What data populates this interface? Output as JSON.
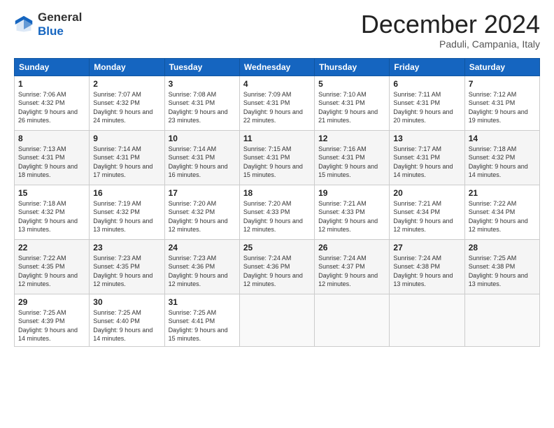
{
  "logo": {
    "general": "General",
    "blue": "Blue"
  },
  "header": {
    "title": "December 2024",
    "subtitle": "Paduli, Campania, Italy"
  },
  "weekdays": [
    "Sunday",
    "Monday",
    "Tuesday",
    "Wednesday",
    "Thursday",
    "Friday",
    "Saturday"
  ],
  "weeks": [
    [
      {
        "day": "1",
        "sunrise": "Sunrise: 7:06 AM",
        "sunset": "Sunset: 4:32 PM",
        "daylight": "Daylight: 9 hours and 26 minutes."
      },
      {
        "day": "2",
        "sunrise": "Sunrise: 7:07 AM",
        "sunset": "Sunset: 4:32 PM",
        "daylight": "Daylight: 9 hours and 24 minutes."
      },
      {
        "day": "3",
        "sunrise": "Sunrise: 7:08 AM",
        "sunset": "Sunset: 4:31 PM",
        "daylight": "Daylight: 9 hours and 23 minutes."
      },
      {
        "day": "4",
        "sunrise": "Sunrise: 7:09 AM",
        "sunset": "Sunset: 4:31 PM",
        "daylight": "Daylight: 9 hours and 22 minutes."
      },
      {
        "day": "5",
        "sunrise": "Sunrise: 7:10 AM",
        "sunset": "Sunset: 4:31 PM",
        "daylight": "Daylight: 9 hours and 21 minutes."
      },
      {
        "day": "6",
        "sunrise": "Sunrise: 7:11 AM",
        "sunset": "Sunset: 4:31 PM",
        "daylight": "Daylight: 9 hours and 20 minutes."
      },
      {
        "day": "7",
        "sunrise": "Sunrise: 7:12 AM",
        "sunset": "Sunset: 4:31 PM",
        "daylight": "Daylight: 9 hours and 19 minutes."
      }
    ],
    [
      {
        "day": "8",
        "sunrise": "Sunrise: 7:13 AM",
        "sunset": "Sunset: 4:31 PM",
        "daylight": "Daylight: 9 hours and 18 minutes."
      },
      {
        "day": "9",
        "sunrise": "Sunrise: 7:14 AM",
        "sunset": "Sunset: 4:31 PM",
        "daylight": "Daylight: 9 hours and 17 minutes."
      },
      {
        "day": "10",
        "sunrise": "Sunrise: 7:14 AM",
        "sunset": "Sunset: 4:31 PM",
        "daylight": "Daylight: 9 hours and 16 minutes."
      },
      {
        "day": "11",
        "sunrise": "Sunrise: 7:15 AM",
        "sunset": "Sunset: 4:31 PM",
        "daylight": "Daylight: 9 hours and 15 minutes."
      },
      {
        "day": "12",
        "sunrise": "Sunrise: 7:16 AM",
        "sunset": "Sunset: 4:31 PM",
        "daylight": "Daylight: 9 hours and 15 minutes."
      },
      {
        "day": "13",
        "sunrise": "Sunrise: 7:17 AM",
        "sunset": "Sunset: 4:31 PM",
        "daylight": "Daylight: 9 hours and 14 minutes."
      },
      {
        "day": "14",
        "sunrise": "Sunrise: 7:18 AM",
        "sunset": "Sunset: 4:32 PM",
        "daylight": "Daylight: 9 hours and 14 minutes."
      }
    ],
    [
      {
        "day": "15",
        "sunrise": "Sunrise: 7:18 AM",
        "sunset": "Sunset: 4:32 PM",
        "daylight": "Daylight: 9 hours and 13 minutes."
      },
      {
        "day": "16",
        "sunrise": "Sunrise: 7:19 AM",
        "sunset": "Sunset: 4:32 PM",
        "daylight": "Daylight: 9 hours and 13 minutes."
      },
      {
        "day": "17",
        "sunrise": "Sunrise: 7:20 AM",
        "sunset": "Sunset: 4:32 PM",
        "daylight": "Daylight: 9 hours and 12 minutes."
      },
      {
        "day": "18",
        "sunrise": "Sunrise: 7:20 AM",
        "sunset": "Sunset: 4:33 PM",
        "daylight": "Daylight: 9 hours and 12 minutes."
      },
      {
        "day": "19",
        "sunrise": "Sunrise: 7:21 AM",
        "sunset": "Sunset: 4:33 PM",
        "daylight": "Daylight: 9 hours and 12 minutes."
      },
      {
        "day": "20",
        "sunrise": "Sunrise: 7:21 AM",
        "sunset": "Sunset: 4:34 PM",
        "daylight": "Daylight: 9 hours and 12 minutes."
      },
      {
        "day": "21",
        "sunrise": "Sunrise: 7:22 AM",
        "sunset": "Sunset: 4:34 PM",
        "daylight": "Daylight: 9 hours and 12 minutes."
      }
    ],
    [
      {
        "day": "22",
        "sunrise": "Sunrise: 7:22 AM",
        "sunset": "Sunset: 4:35 PM",
        "daylight": "Daylight: 9 hours and 12 minutes."
      },
      {
        "day": "23",
        "sunrise": "Sunrise: 7:23 AM",
        "sunset": "Sunset: 4:35 PM",
        "daylight": "Daylight: 9 hours and 12 minutes."
      },
      {
        "day": "24",
        "sunrise": "Sunrise: 7:23 AM",
        "sunset": "Sunset: 4:36 PM",
        "daylight": "Daylight: 9 hours and 12 minutes."
      },
      {
        "day": "25",
        "sunrise": "Sunrise: 7:24 AM",
        "sunset": "Sunset: 4:36 PM",
        "daylight": "Daylight: 9 hours and 12 minutes."
      },
      {
        "day": "26",
        "sunrise": "Sunrise: 7:24 AM",
        "sunset": "Sunset: 4:37 PM",
        "daylight": "Daylight: 9 hours and 12 minutes."
      },
      {
        "day": "27",
        "sunrise": "Sunrise: 7:24 AM",
        "sunset": "Sunset: 4:38 PM",
        "daylight": "Daylight: 9 hours and 13 minutes."
      },
      {
        "day": "28",
        "sunrise": "Sunrise: 7:25 AM",
        "sunset": "Sunset: 4:38 PM",
        "daylight": "Daylight: 9 hours and 13 minutes."
      }
    ],
    [
      {
        "day": "29",
        "sunrise": "Sunrise: 7:25 AM",
        "sunset": "Sunset: 4:39 PM",
        "daylight": "Daylight: 9 hours and 14 minutes."
      },
      {
        "day": "30",
        "sunrise": "Sunrise: 7:25 AM",
        "sunset": "Sunset: 4:40 PM",
        "daylight": "Daylight: 9 hours and 14 minutes."
      },
      {
        "day": "31",
        "sunrise": "Sunrise: 7:25 AM",
        "sunset": "Sunset: 4:41 PM",
        "daylight": "Daylight: 9 hours and 15 minutes."
      },
      null,
      null,
      null,
      null
    ]
  ]
}
